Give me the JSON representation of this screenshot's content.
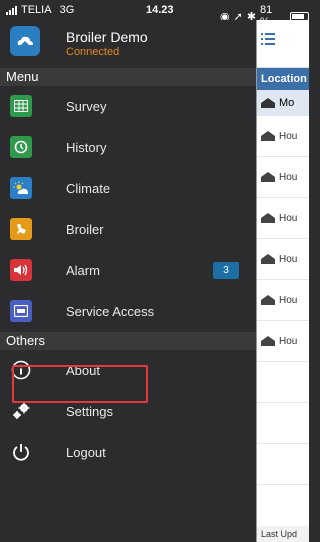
{
  "status_bar": {
    "carrier": "TELIA",
    "network": "3G",
    "time": "14.23",
    "battery": "81 %"
  },
  "app": {
    "title": "Broiler Demo",
    "status": "Connected"
  },
  "menu": {
    "header": "Menu",
    "items": [
      {
        "label": "Survey",
        "icon": "grid-icon",
        "color": "#2f9a4b"
      },
      {
        "label": "History",
        "icon": "history-icon",
        "color": "#2f9a4b"
      },
      {
        "label": "Climate",
        "icon": "climate-icon",
        "color": "#2a7fc6"
      },
      {
        "label": "Broiler",
        "icon": "broiler-icon",
        "color": "#e59b1a"
      },
      {
        "label": "Alarm",
        "icon": "speaker-icon",
        "color": "#d6333a",
        "badge": "3"
      },
      {
        "label": "Service Access",
        "icon": "service-icon",
        "color": "#4a5fc2"
      }
    ]
  },
  "others": {
    "header": "Others",
    "items": [
      {
        "label": "About",
        "icon": "info-icon"
      },
      {
        "label": "Settings",
        "icon": "gears-icon"
      },
      {
        "label": "Logout",
        "icon": "power-icon"
      }
    ]
  },
  "content": {
    "header": "Location",
    "selected": "Mo",
    "rows": [
      "Hou",
      "Hou",
      "Hou",
      "Hou",
      "Hou",
      "Hou"
    ],
    "footer": "Last Upd"
  },
  "colors": {
    "highlight": "#e0393e",
    "accent": "#3b6fa8",
    "warning": "#e08a1e"
  }
}
